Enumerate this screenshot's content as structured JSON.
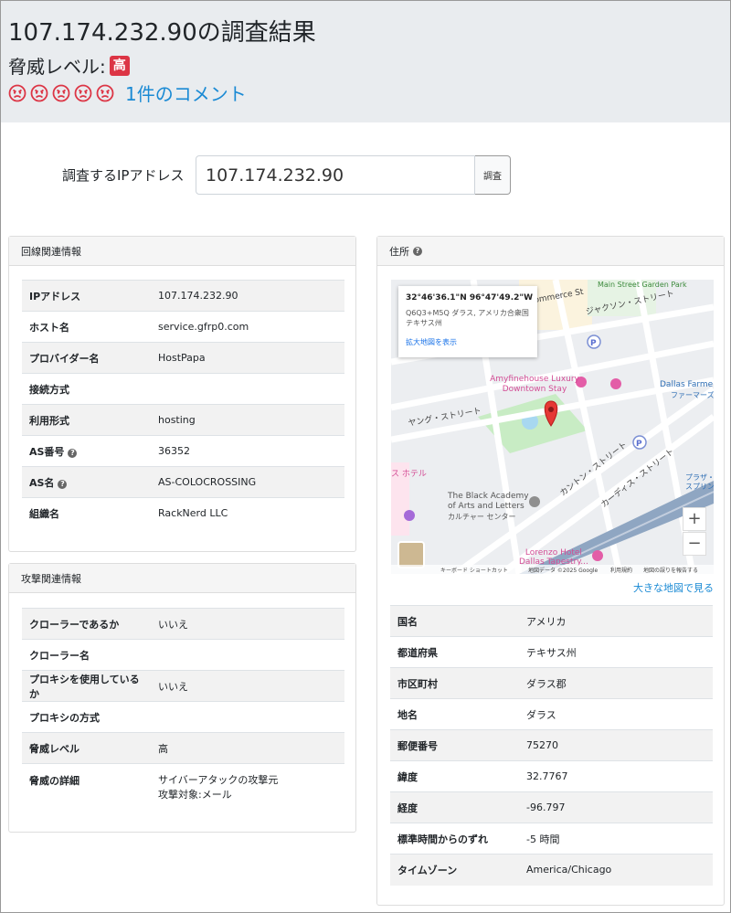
{
  "page": {
    "title": "107.174.232.90の調査結果",
    "threat_label": "脅威レベル:",
    "threat_badge": "高",
    "comment_link": "1件のコメント"
  },
  "search": {
    "label": "調査するIPアドレス",
    "value": "107.174.232.90",
    "button": "調査"
  },
  "line_info": {
    "title": "回線関連情報",
    "rows": [
      {
        "key": "IPアドレス",
        "value": "107.174.232.90"
      },
      {
        "key": "ホスト名",
        "value": "service.gfrp0.com"
      },
      {
        "key": "プロバイダー名",
        "value": "HostPapa"
      },
      {
        "key": "接続方式",
        "value": ""
      },
      {
        "key": "利用形式",
        "value": "hosting"
      },
      {
        "key": "AS番号",
        "value": "36352"
      },
      {
        "key": "AS名",
        "value": "AS-COLOCROSSING"
      },
      {
        "key": "組織名",
        "value": "RackNerd LLC"
      }
    ]
  },
  "attack_info": {
    "title": "攻撃関連情報",
    "rows": [
      {
        "key": "クローラーであるか",
        "value": "いいえ"
      },
      {
        "key": "クローラー名",
        "value": ""
      },
      {
        "key": "プロキシを使用しているか",
        "value": "いいえ"
      },
      {
        "key": "プロキシの方式",
        "value": ""
      },
      {
        "key": "脅威レベル",
        "value": "高"
      }
    ],
    "detail_key": "脅威の詳細",
    "detail_line1": "サイバーアタックの攻撃元",
    "detail_line2": "攻撃対象:メール"
  },
  "address": {
    "title": "住所",
    "map_link": "大きな地図で見る",
    "rows": [
      {
        "key": "国名",
        "value": "アメリカ"
      },
      {
        "key": "都道府県",
        "value": "テキサス州"
      },
      {
        "key": "市区町村",
        "value": "ダラス郡"
      },
      {
        "key": "地名",
        "value": "ダラス"
      },
      {
        "key": "郵便番号",
        "value": "75270"
      },
      {
        "key": "緯度",
        "value": "32.7767"
      },
      {
        "key": "経度",
        "value": "-96.797"
      },
      {
        "key": "標準時間からのずれ",
        "value": "-5 時間"
      },
      {
        "key": "タイムゾーン",
        "value": "America/Chicago"
      }
    ]
  },
  "map": {
    "coords": "32°46'36.1\"N 96°47'49.2\"W",
    "plus_code": "Q6Q3+M5Q ダラス, アメリカ合衆国",
    "region": "テキサス州",
    "enlarge": "拡大地図を表示",
    "labels": {
      "street1": "Commerce St",
      "street2": "ジャクソン・ストリート",
      "park": "Main Street Garden Park",
      "hotel": "Amyfinehouse Luxury Downtown Stay",
      "farmers": "Dallas Farme",
      "farmers_jp": "ファーマーズ",
      "young_st": "ヤング・ストリート",
      "hotel2": "ス ホテル",
      "academy1": "The Black Academy",
      "academy2": "of Arts and Letters",
      "academy3": "カルチャー センター",
      "canton": "カントン・ストリート",
      "cadiz": "カーディス・ストリート",
      "plaza1": "プラザ・",
      "plaza2": "スプリン",
      "lorenzo1": "Lorenzo Hotel",
      "lorenzo2": "Dallas Tapestry...",
      "footer_keys": "キーボード ショートカット",
      "footer_data": "地図データ ©2025 Google",
      "footer_terms": "利用規約",
      "footer_report": "地図の誤りを報告する"
    }
  },
  "colors": {
    "badge": "#dc3545",
    "link": "#1a8ad4",
    "header_bg": "#e9ecef",
    "face": "#dc3545"
  }
}
